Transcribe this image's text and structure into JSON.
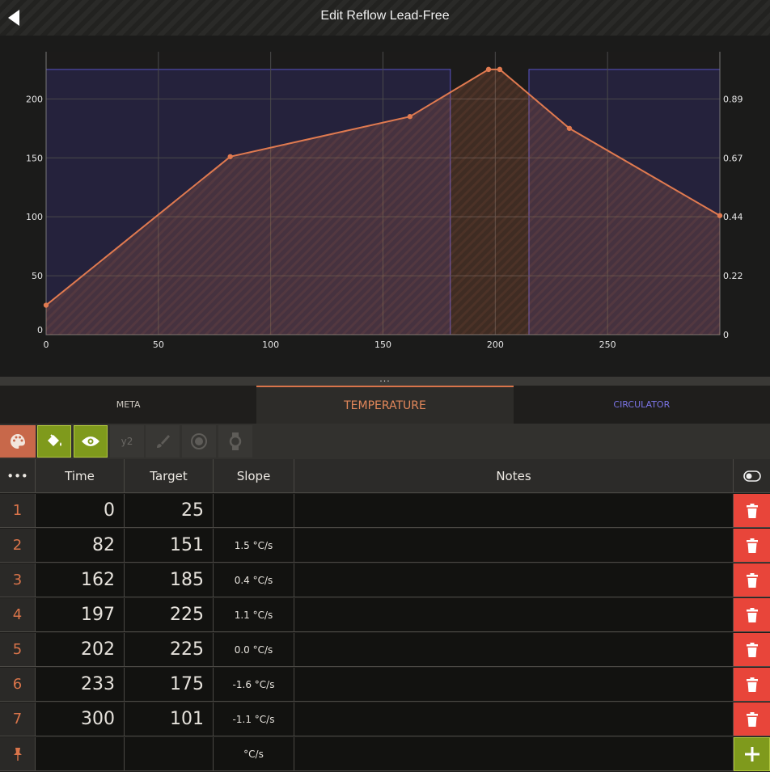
{
  "header": {
    "title": "Edit Reflow Lead-Free",
    "back_icon": "back-arrow-icon"
  },
  "tabs": [
    {
      "label": "META",
      "active": false
    },
    {
      "label": "TEMPERATURE",
      "active": true
    },
    {
      "label": "CIRCULATOR",
      "active": false
    }
  ],
  "toolbar": {
    "items": [
      {
        "icon": "palette-icon",
        "state": "orange"
      },
      {
        "icon": "paint-bucket-icon",
        "state": "active"
      },
      {
        "icon": "eye-icon",
        "state": "active"
      },
      {
        "icon": "y2-icon",
        "label": "y2",
        "state": "disabled"
      },
      {
        "icon": "brush-icon",
        "state": "disabled"
      },
      {
        "icon": "target-icon",
        "state": "disabled"
      },
      {
        "icon": "watch-icon",
        "state": "disabled"
      }
    ]
  },
  "divider": {
    "grip": "..."
  },
  "table": {
    "headers": {
      "menu": "•••",
      "time": "Time",
      "target": "Target",
      "slope": "Slope",
      "notes": "Notes"
    },
    "rows": [
      {
        "index": "1",
        "time": "0",
        "target": "25",
        "slope": "",
        "notes": ""
      },
      {
        "index": "2",
        "time": "82",
        "target": "151",
        "slope": "1.5 °C/s",
        "notes": ""
      },
      {
        "index": "3",
        "time": "162",
        "target": "185",
        "slope": "0.4 °C/s",
        "notes": ""
      },
      {
        "index": "4",
        "time": "197",
        "target": "225",
        "slope": "1.1 °C/s",
        "notes": ""
      },
      {
        "index": "5",
        "time": "202",
        "target": "225",
        "slope": "0.0 °C/s",
        "notes": ""
      },
      {
        "index": "6",
        "time": "233",
        "target": "175",
        "slope": "-1.6 °C/s",
        "notes": ""
      },
      {
        "index": "7",
        "time": "300",
        "target": "101",
        "slope": "-1.1 °C/s",
        "notes": ""
      }
    ],
    "new_row": {
      "slope": "°C/s"
    }
  },
  "colors": {
    "accent": "#d9744a",
    "line": "#e07a50",
    "circulator": "#7b74e6",
    "delete": "#e8453a",
    "add": "#7f9a1c"
  },
  "chart_data": {
    "type": "line",
    "x": [
      0,
      82,
      162,
      197,
      202,
      233,
      300
    ],
    "series": [
      {
        "values": [
          25,
          151,
          185,
          225,
          225,
          175,
          101
        ]
      }
    ],
    "xlim": [
      0,
      300
    ],
    "ylim": [
      0,
      240
    ],
    "xticks": [
      0,
      50,
      100,
      150,
      200,
      250
    ],
    "yticks": [
      0,
      50,
      100,
      150,
      200
    ],
    "y2ticks": [
      "0",
      "0.22",
      "0.44",
      "0.67",
      "0.89"
    ],
    "y2_values": [
      0,
      50,
      100,
      150,
      200
    ],
    "circulator_on": [
      [
        0,
        180
      ],
      [
        215,
        300
      ]
    ],
    "circulator_level": 225,
    "grid": true
  }
}
